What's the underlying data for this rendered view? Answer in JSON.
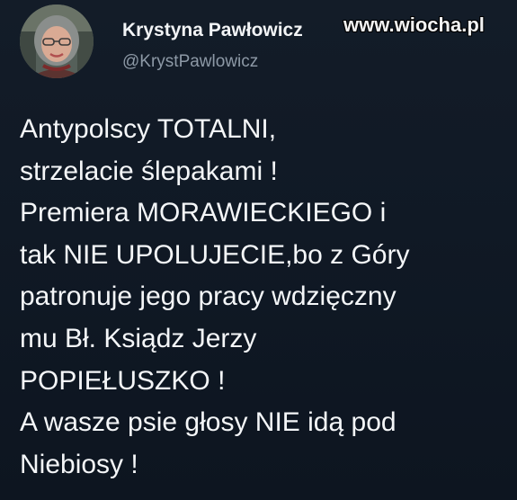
{
  "author": {
    "name": "Krystyna Pawłowicz",
    "handle": "@KrystPawlowicz",
    "avatar_icon": "profile-photo"
  },
  "watermark": "www.wiocha.pl",
  "tweet": {
    "lines": [
      "Antypolscy TOTALNI,",
      "strzelacie ślepakami !",
      "Premiera MORAWIECKIEGO i",
      "tak NIE UPOLUJECIE,bo z Góry",
      "patronuje jego pracy wdzięczny",
      "mu Bł. Ksiądz Jerzy",
      "POPIEŁUSZKO !",
      "A wasze psie głosy NIE idą pod",
      "Niebiosy !"
    ]
  },
  "colors": {
    "background": "#101925",
    "name_text": "#f2f4f6",
    "handle_text": "#8d99a6",
    "tweet_text": "#f4f6f8"
  }
}
